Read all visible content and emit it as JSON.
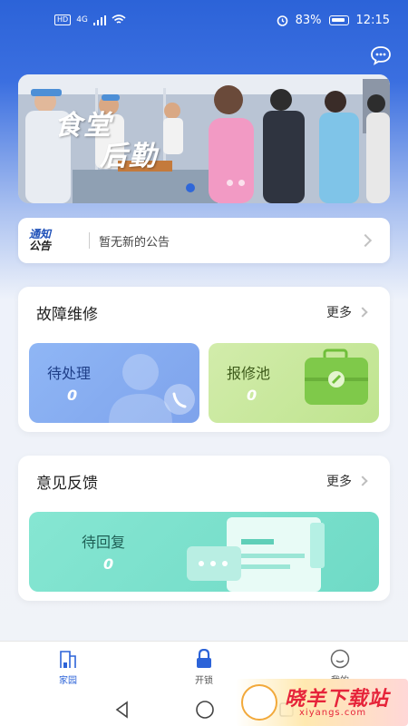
{
  "status": {
    "chip": "HD",
    "network": "4G",
    "battery": "83%",
    "time": "12:15"
  },
  "banner": {
    "title_line1": "食堂",
    "title_line2": "后勤"
  },
  "notice": {
    "badge_line1": "通知",
    "badge_line2": "公告",
    "text": "暂无新的公告"
  },
  "repair": {
    "title": "故障维修",
    "more": "更多",
    "pending": {
      "label": "待处理",
      "count": "0"
    },
    "pool": {
      "label": "报修池",
      "count": "0"
    }
  },
  "feedback": {
    "title": "意见反馈",
    "more": "更多",
    "reply": {
      "label": "待回复",
      "count": "0"
    }
  },
  "nav": {
    "home": "家园",
    "unlock": "开锁",
    "mine": "我的"
  },
  "watermark": {
    "text": "晓羊下载站",
    "sub": "xiyangs.com"
  },
  "colors": {
    "accent": "#2c63d8",
    "pending_tile": "#8fb3f3",
    "pool_tile": "#c9e89b",
    "reply_tile": "#7fe0cd"
  }
}
